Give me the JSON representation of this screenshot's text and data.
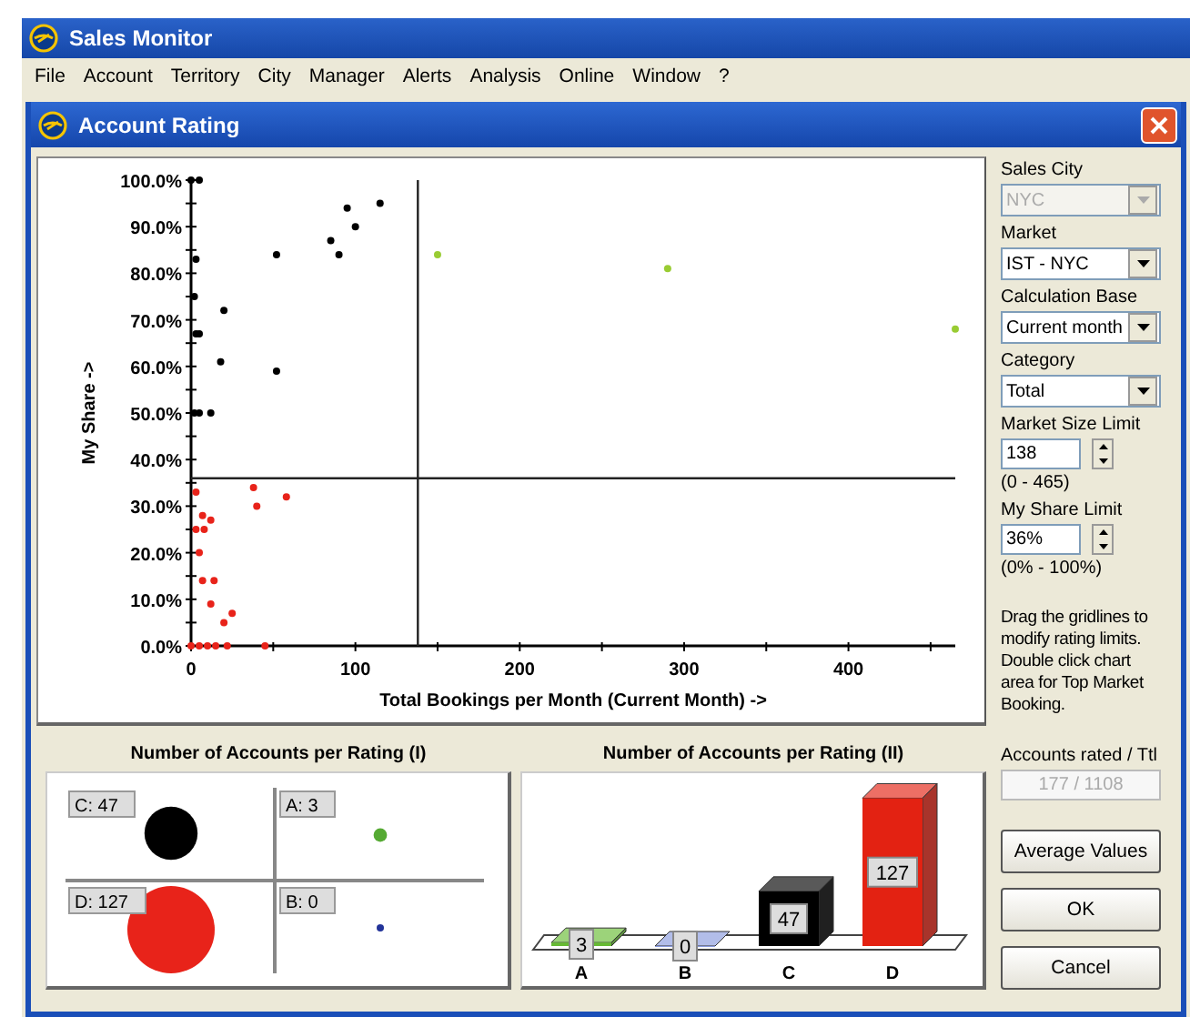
{
  "app": {
    "title": "Sales Monitor"
  },
  "menu": [
    {
      "label": "File"
    },
    {
      "label": "Account"
    },
    {
      "label": "Territory"
    },
    {
      "label": "City"
    },
    {
      "label": "Manager"
    },
    {
      "label": "Alerts"
    },
    {
      "label": "Analysis"
    },
    {
      "label": "Online"
    },
    {
      "label": "Window"
    },
    {
      "label": "?"
    }
  ],
  "dialog": {
    "title": "Account Rating"
  },
  "scatter": {
    "chart_data": {
      "type": "scatter",
      "xlabel": "Total Bookings per Month (Current Month) ->",
      "ylabel": "My Share ->",
      "xlim": [
        0,
        465
      ],
      "ylim": [
        0,
        100
      ],
      "xticks": [
        0,
        100,
        200,
        300,
        400
      ],
      "yticks": [
        {
          "value": 0,
          "label": "0.0%"
        },
        {
          "value": 10,
          "label": "10.0%"
        },
        {
          "value": 20,
          "label": "20.0%"
        },
        {
          "value": 30,
          "label": "30.0%"
        },
        {
          "value": 40,
          "label": "40.0%"
        },
        {
          "value": 50,
          "label": "50.0%"
        },
        {
          "value": 60,
          "label": "60.0%"
        },
        {
          "value": 70,
          "label": "70.0%"
        },
        {
          "value": 80,
          "label": "80.0%"
        },
        {
          "value": 90,
          "label": "90.0%"
        },
        {
          "value": 100,
          "label": "100.0%"
        }
      ],
      "series": [
        {
          "color": "#000000",
          "x": [
            0,
            5,
            3,
            2,
            3,
            5,
            2,
            5,
            12,
            20,
            18,
            52,
            52,
            85,
            90,
            95,
            100,
            115
          ],
          "values": [
            100,
            100,
            83,
            75,
            67,
            67,
            50,
            50,
            50,
            72,
            61,
            84,
            59,
            87,
            84,
            94,
            90,
            95
          ]
        },
        {
          "color": "#99cc33",
          "x": [
            150,
            290,
            465
          ],
          "values": [
            84,
            81,
            68
          ]
        },
        {
          "color": "#e8231a",
          "x": [
            3,
            7,
            12,
            3,
            8,
            5,
            7,
            14,
            12,
            20,
            25,
            38,
            40,
            58,
            0,
            5,
            10,
            15,
            22,
            45
          ],
          "values": [
            33,
            28,
            27,
            25,
            25,
            20,
            14,
            14,
            9,
            5,
            7,
            34,
            30,
            32,
            0,
            0,
            0,
            0,
            0,
            0
          ]
        }
      ],
      "ref_lines": [
        {
          "axis": "x",
          "value": 138
        },
        {
          "axis": "y",
          "value": 36
        }
      ]
    }
  },
  "bubbles": {
    "title": "Number of Accounts per Rating (I)",
    "quadrants": [
      {
        "label": "C: 47",
        "color": "#000000"
      },
      {
        "label": "A: 3",
        "color": "#55aa33"
      },
      {
        "label": "D: 127",
        "color": "#e8231a"
      },
      {
        "label": "B: 0",
        "color": "#223399"
      }
    ]
  },
  "bars": {
    "chart_data": {
      "type": "bar",
      "title": "Number of Accounts per Rating (II)",
      "categories": [
        "A",
        "B",
        "C",
        "D"
      ],
      "data_labels": true,
      "series": [
        {
          "color": "#66bb33",
          "values": [
            3,
            null,
            null,
            null
          ]
        },
        {
          "color": "#8899dd",
          "values": [
            null,
            0,
            null,
            null
          ]
        },
        {
          "color": "#000000",
          "values": [
            null,
            null,
            47,
            null
          ]
        },
        {
          "color": "#e32212",
          "values": [
            null,
            null,
            null,
            127
          ]
        }
      ]
    }
  },
  "sidebar": {
    "fields": [
      {
        "kind": "dropdown",
        "label": "Sales City",
        "value": "NYC",
        "disabled": true
      },
      {
        "kind": "dropdown",
        "label": "Market",
        "value": "IST - NYC",
        "disabled": false
      },
      {
        "kind": "dropdown",
        "label": "Calculation Base",
        "value": "Current month",
        "disabled": false
      },
      {
        "kind": "dropdown",
        "label": "Category",
        "value": "Total",
        "disabled": false
      },
      {
        "kind": "spinner",
        "label": "Market Size Limit",
        "value": "138",
        "range": "(0 - 465)",
        "disabled": false
      },
      {
        "kind": "spinner",
        "label": "My Share Limit",
        "value": "36%",
        "range": "(0% - 100%)",
        "disabled": false
      }
    ],
    "hint": "Drag the gridlines to modify rating limits. Double click chart area for Top Market Booking.",
    "total": {
      "label": "Accounts rated / Ttl",
      "value": "177 / 1108",
      "disabled": true
    },
    "buttons": [
      {
        "label": "Average Values"
      },
      {
        "label": "OK"
      },
      {
        "label": "Cancel"
      }
    ]
  }
}
